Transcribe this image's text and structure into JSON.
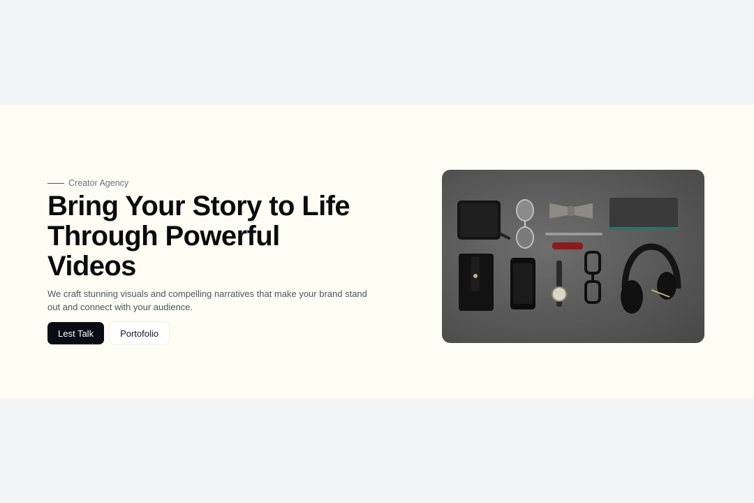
{
  "hero": {
    "eyebrow": "Creator Agency",
    "title_lines": [
      "Bring Your Story to Life",
      "Through Powerful",
      "Videos"
    ],
    "description": "We craft stunning visuals and compelling narratives that make your brand stand out and connect with your audience.",
    "primary_button": "Lest Talk",
    "secondary_button": "Portofolio"
  },
  "colors": {
    "page_bg": "#f3f4f6",
    "hero_bg": "#fdfdf4",
    "primary_button_bg": "#0a0c14",
    "text_dark": "#0b0b0f",
    "text_muted": "#4b5563"
  },
  "photo": {
    "subject": "flat-lay of personal accessories on grey surface",
    "objects": [
      "wallet",
      "sunglasses",
      "bow-tie",
      "notebook",
      "pen",
      "pocket-knife",
      "phone-case",
      "smartphone",
      "wristwatch",
      "eyeglasses",
      "headphones"
    ]
  }
}
